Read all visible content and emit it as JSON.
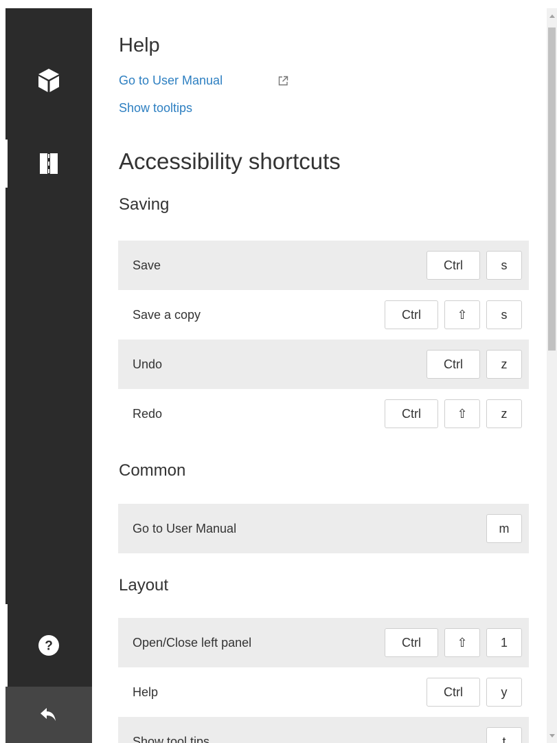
{
  "help": {
    "title": "Help",
    "user_manual_link": "Go to User Manual",
    "tooltips_link": "Show tooltips"
  },
  "shortcuts": {
    "title": "Accessibility shortcuts",
    "sections": {
      "saving": {
        "title": "Saving",
        "rows": [
          {
            "label": "Save",
            "keys": [
              "Ctrl",
              "s"
            ]
          },
          {
            "label": "Save a copy",
            "keys": [
              "Ctrl",
              "⇧",
              "s"
            ]
          },
          {
            "label": "Undo",
            "keys": [
              "Ctrl",
              "z"
            ]
          },
          {
            "label": "Redo",
            "keys": [
              "Ctrl",
              "⇧",
              "z"
            ]
          }
        ]
      },
      "common": {
        "title": "Common",
        "rows": [
          {
            "label": "Go to User Manual",
            "keys": [
              "m"
            ]
          }
        ]
      },
      "layout": {
        "title": "Layout",
        "rows": [
          {
            "label": "Open/Close left panel",
            "keys": [
              "Ctrl",
              "⇧",
              "1"
            ]
          },
          {
            "label": "Help",
            "keys": [
              "Ctrl",
              "y"
            ]
          },
          {
            "label": "Show tool tips",
            "keys": [
              "t"
            ]
          }
        ]
      }
    }
  },
  "rail": {
    "icons": [
      "cube-icon",
      "dashed-road-icon",
      "help-circle-icon",
      "back-arrow-icon"
    ],
    "background": "#2b2b2b",
    "active_indicator": "#ffffff"
  },
  "colors": {
    "link": "#2d7fc1",
    "row_shade": "#ececec",
    "text": "#333333"
  }
}
